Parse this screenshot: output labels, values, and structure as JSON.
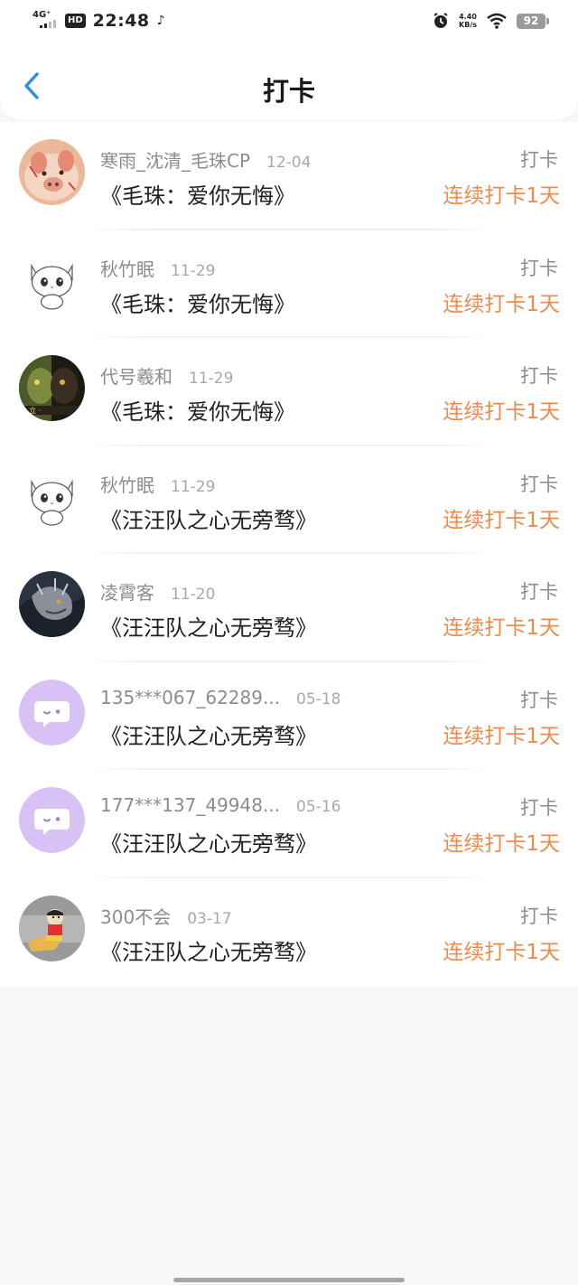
{
  "status_bar": {
    "network": "4G⁺",
    "hd": "HD",
    "time": "22:48",
    "speed_value": "4.40",
    "speed_unit": "KB/s",
    "battery": "92",
    "icons": [
      "signal-icon",
      "music-icon",
      "alarm-icon",
      "wifi-icon",
      "battery-icon"
    ]
  },
  "header": {
    "title": "打卡",
    "back_icon": "chevron-left-icon",
    "accent_color": "#2b8fe0"
  },
  "checkins": [
    {
      "user": "寒雨_沈清_毛珠CP",
      "date": "12-04",
      "book": "《毛珠：爱你无悔》",
      "action": "打卡",
      "streak": "连续打卡1天",
      "avatar": "cartoon-pig-avatar"
    },
    {
      "user": "秋竹眠",
      "date": "11-29",
      "book": "《毛珠：爱你无悔》",
      "action": "打卡",
      "streak": "连续打卡1天",
      "avatar": "white-cat-avatar"
    },
    {
      "user": "代号羲和",
      "date": "11-29",
      "book": "《毛珠：爱你无悔》",
      "action": "打卡",
      "streak": "连续打卡1天",
      "avatar": "movie-poster-avatar"
    },
    {
      "user": "秋竹眠",
      "date": "11-29",
      "book": "《汪汪队之心无旁骛》",
      "action": "打卡",
      "streak": "连续打卡1天",
      "avatar": "white-cat-avatar"
    },
    {
      "user": "凌霄客",
      "date": "11-20",
      "book": "《汪汪队之心无旁骛》",
      "action": "打卡",
      "streak": "连续打卡1天",
      "avatar": "dragon-avatar"
    },
    {
      "user": "135***067_62289...",
      "date": "05-18",
      "book": "《汪汪队之心无旁骛》",
      "action": "打卡",
      "streak": "连续打卡1天",
      "avatar": "default-chat-avatar"
    },
    {
      "user": "177***137_49948...",
      "date": "05-16",
      "book": "《汪汪队之心无旁骛》",
      "action": "打卡",
      "streak": "连续打卡1天",
      "avatar": "default-chat-avatar"
    },
    {
      "user": "300不会",
      "date": "03-17",
      "book": "《汪汪队之心无旁骛》",
      "action": "打卡",
      "streak": "连续打卡1天",
      "avatar": "crayon-shin-chan-avatar"
    }
  ],
  "colors": {
    "streak": "#ee8a4c",
    "username": "#8c8c8c",
    "default_avatar_bg": "#d8c2f5"
  }
}
